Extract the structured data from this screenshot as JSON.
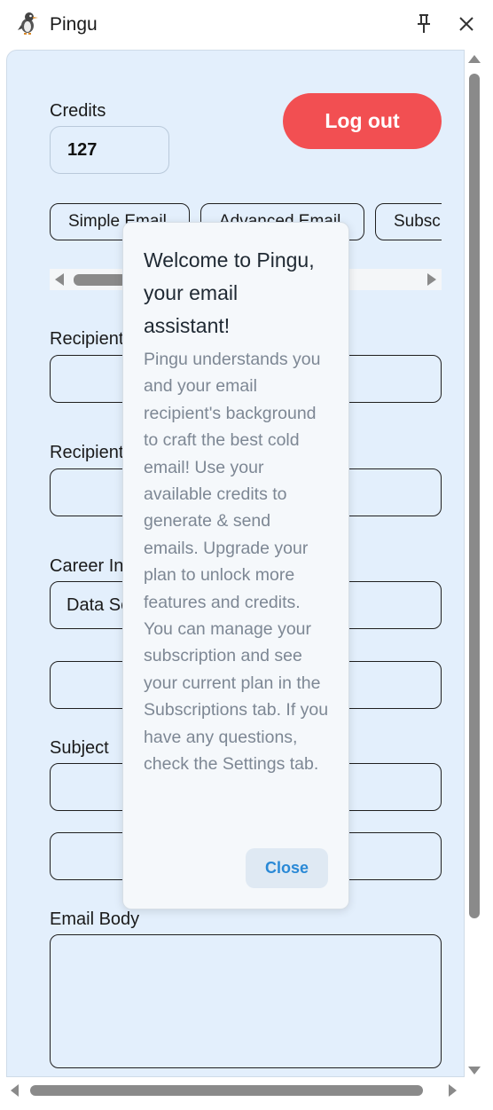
{
  "window": {
    "title": "Pingu"
  },
  "account": {
    "credits_label": "Credits",
    "credits_value": "127",
    "logout_label": "Log out"
  },
  "tabs": [
    {
      "label": "Simple Email"
    },
    {
      "label": "Advanced Email"
    },
    {
      "label": "Subscriptions"
    }
  ],
  "form": {
    "recipient_label_1": "Recipient",
    "recipient_label_2": "Recipient",
    "career_label": "Career Interest",
    "career_value": "Data Science",
    "subject_label": "Subject",
    "body_label": "Email Body"
  },
  "modal": {
    "title": "Welcome to Pingu, your email assistant!",
    "text": "Pingu understands you and your email recipient's background to craft the best cold email! Use your available credits to generate & send emails. Upgrade your plan to unlock more features and credits. You can manage your subscription and see your current plan in the Subscriptions tab. If you have any questions, check the Settings tab.",
    "close_label": "Close"
  },
  "colors": {
    "panel_bg": "#e3effc",
    "logout_bg": "#f24f52",
    "modal_bg": "#f5f8fb",
    "close_text": "#2a89d6"
  },
  "icons": [
    "pingu-logo-icon",
    "pin-icon",
    "close-icon"
  ]
}
